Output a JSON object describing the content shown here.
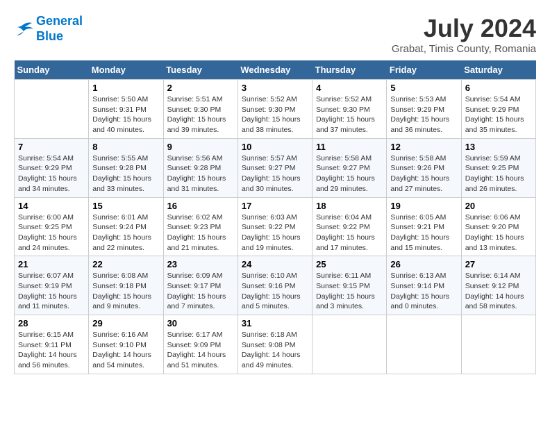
{
  "logo": {
    "line1": "General",
    "line2": "Blue"
  },
  "title": "July 2024",
  "subtitle": "Grabat, Timis County, Romania",
  "days_header": [
    "Sunday",
    "Monday",
    "Tuesday",
    "Wednesday",
    "Thursday",
    "Friday",
    "Saturday"
  ],
  "weeks": [
    [
      {
        "day": "",
        "info": ""
      },
      {
        "day": "1",
        "info": "Sunrise: 5:50 AM\nSunset: 9:31 PM\nDaylight: 15 hours\nand 40 minutes."
      },
      {
        "day": "2",
        "info": "Sunrise: 5:51 AM\nSunset: 9:30 PM\nDaylight: 15 hours\nand 39 minutes."
      },
      {
        "day": "3",
        "info": "Sunrise: 5:52 AM\nSunset: 9:30 PM\nDaylight: 15 hours\nand 38 minutes."
      },
      {
        "day": "4",
        "info": "Sunrise: 5:52 AM\nSunset: 9:30 PM\nDaylight: 15 hours\nand 37 minutes."
      },
      {
        "day": "5",
        "info": "Sunrise: 5:53 AM\nSunset: 9:29 PM\nDaylight: 15 hours\nand 36 minutes."
      },
      {
        "day": "6",
        "info": "Sunrise: 5:54 AM\nSunset: 9:29 PM\nDaylight: 15 hours\nand 35 minutes."
      }
    ],
    [
      {
        "day": "7",
        "info": "Sunrise: 5:54 AM\nSunset: 9:29 PM\nDaylight: 15 hours\nand 34 minutes."
      },
      {
        "day": "8",
        "info": "Sunrise: 5:55 AM\nSunset: 9:28 PM\nDaylight: 15 hours\nand 33 minutes."
      },
      {
        "day": "9",
        "info": "Sunrise: 5:56 AM\nSunset: 9:28 PM\nDaylight: 15 hours\nand 31 minutes."
      },
      {
        "day": "10",
        "info": "Sunrise: 5:57 AM\nSunset: 9:27 PM\nDaylight: 15 hours\nand 30 minutes."
      },
      {
        "day": "11",
        "info": "Sunrise: 5:58 AM\nSunset: 9:27 PM\nDaylight: 15 hours\nand 29 minutes."
      },
      {
        "day": "12",
        "info": "Sunrise: 5:58 AM\nSunset: 9:26 PM\nDaylight: 15 hours\nand 27 minutes."
      },
      {
        "day": "13",
        "info": "Sunrise: 5:59 AM\nSunset: 9:25 PM\nDaylight: 15 hours\nand 26 minutes."
      }
    ],
    [
      {
        "day": "14",
        "info": "Sunrise: 6:00 AM\nSunset: 9:25 PM\nDaylight: 15 hours\nand 24 minutes."
      },
      {
        "day": "15",
        "info": "Sunrise: 6:01 AM\nSunset: 9:24 PM\nDaylight: 15 hours\nand 22 minutes."
      },
      {
        "day": "16",
        "info": "Sunrise: 6:02 AM\nSunset: 9:23 PM\nDaylight: 15 hours\nand 21 minutes."
      },
      {
        "day": "17",
        "info": "Sunrise: 6:03 AM\nSunset: 9:22 PM\nDaylight: 15 hours\nand 19 minutes."
      },
      {
        "day": "18",
        "info": "Sunrise: 6:04 AM\nSunset: 9:22 PM\nDaylight: 15 hours\nand 17 minutes."
      },
      {
        "day": "19",
        "info": "Sunrise: 6:05 AM\nSunset: 9:21 PM\nDaylight: 15 hours\nand 15 minutes."
      },
      {
        "day": "20",
        "info": "Sunrise: 6:06 AM\nSunset: 9:20 PM\nDaylight: 15 hours\nand 13 minutes."
      }
    ],
    [
      {
        "day": "21",
        "info": "Sunrise: 6:07 AM\nSunset: 9:19 PM\nDaylight: 15 hours\nand 11 minutes."
      },
      {
        "day": "22",
        "info": "Sunrise: 6:08 AM\nSunset: 9:18 PM\nDaylight: 15 hours\nand 9 minutes."
      },
      {
        "day": "23",
        "info": "Sunrise: 6:09 AM\nSunset: 9:17 PM\nDaylight: 15 hours\nand 7 minutes."
      },
      {
        "day": "24",
        "info": "Sunrise: 6:10 AM\nSunset: 9:16 PM\nDaylight: 15 hours\nand 5 minutes."
      },
      {
        "day": "25",
        "info": "Sunrise: 6:11 AM\nSunset: 9:15 PM\nDaylight: 15 hours\nand 3 minutes."
      },
      {
        "day": "26",
        "info": "Sunrise: 6:13 AM\nSunset: 9:14 PM\nDaylight: 15 hours\nand 0 minutes."
      },
      {
        "day": "27",
        "info": "Sunrise: 6:14 AM\nSunset: 9:12 PM\nDaylight: 14 hours\nand 58 minutes."
      }
    ],
    [
      {
        "day": "28",
        "info": "Sunrise: 6:15 AM\nSunset: 9:11 PM\nDaylight: 14 hours\nand 56 minutes."
      },
      {
        "day": "29",
        "info": "Sunrise: 6:16 AM\nSunset: 9:10 PM\nDaylight: 14 hours\nand 54 minutes."
      },
      {
        "day": "30",
        "info": "Sunrise: 6:17 AM\nSunset: 9:09 PM\nDaylight: 14 hours\nand 51 minutes."
      },
      {
        "day": "31",
        "info": "Sunrise: 6:18 AM\nSunset: 9:08 PM\nDaylight: 14 hours\nand 49 minutes."
      },
      {
        "day": "",
        "info": ""
      },
      {
        "day": "",
        "info": ""
      },
      {
        "day": "",
        "info": ""
      }
    ]
  ]
}
